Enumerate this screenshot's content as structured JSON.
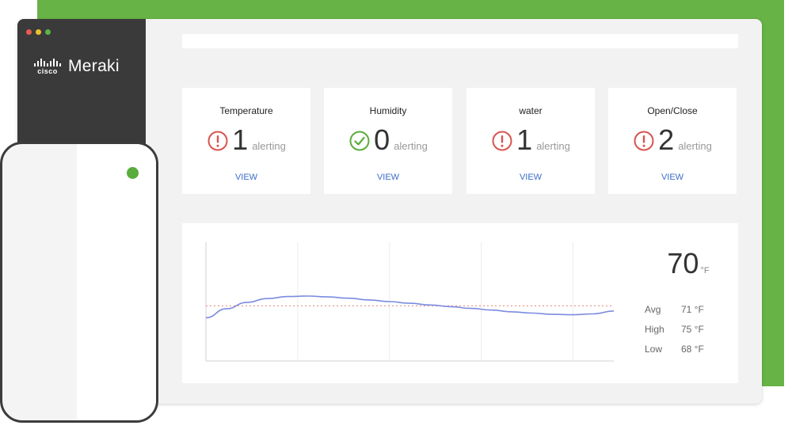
{
  "brand": {
    "cisco": "cisco",
    "product": "Meraki"
  },
  "window": {
    "traffic_colors": [
      "#e85d4f",
      "#f2be2c",
      "#5cb547"
    ]
  },
  "colors": {
    "accent_green": "#67b346",
    "alert_red": "#d9534f",
    "ok_green": "#5aac3c",
    "link_blue": "#3a6cc9",
    "series_blue": "#7b8be0",
    "threshold_red": "#e89b8b"
  },
  "cards": [
    {
      "title": "Temperature",
      "count": "1",
      "unit": "alerting",
      "link": "VIEW",
      "status": "alert-icon"
    },
    {
      "title": "Humidity",
      "count": "0",
      "unit": "alerting",
      "link": "VIEW",
      "status": "check-icon"
    },
    {
      "title": "water",
      "count": "1",
      "unit": "alerting",
      "link": "VIEW",
      "status": "alert-icon"
    },
    {
      "title": "Open/Close",
      "count": "2",
      "unit": "alerting",
      "link": "VIEW",
      "status": "alert-icon"
    }
  ],
  "readout": {
    "current": "70",
    "unit": "°F",
    "stats": [
      {
        "label": "Avg",
        "value": "71 °F"
      },
      {
        "label": "High",
        "value": "75 °F"
      },
      {
        "label": "Low",
        "value": "68 °F"
      }
    ]
  },
  "chart_data": {
    "type": "line",
    "title": "",
    "xlabel": "",
    "ylabel": "",
    "grid": true,
    "x": [
      0,
      5,
      10,
      15,
      20,
      25,
      30,
      35,
      40,
      45,
      50,
      55,
      60,
      65,
      70,
      75,
      80,
      85,
      90,
      95,
      100
    ],
    "ylim": [
      58,
      86
    ],
    "xlim": [
      0,
      100
    ],
    "series": [
      {
        "values": [
          68.2,
          70.3,
          71.8,
          72.7,
          73.2,
          73.3,
          73.1,
          72.8,
          72.4,
          72.0,
          71.6,
          71.2,
          70.8,
          70.4,
          70.0,
          69.6,
          69.3,
          69.0,
          68.9,
          69.1,
          69.8
        ]
      }
    ],
    "threshold": 71
  }
}
